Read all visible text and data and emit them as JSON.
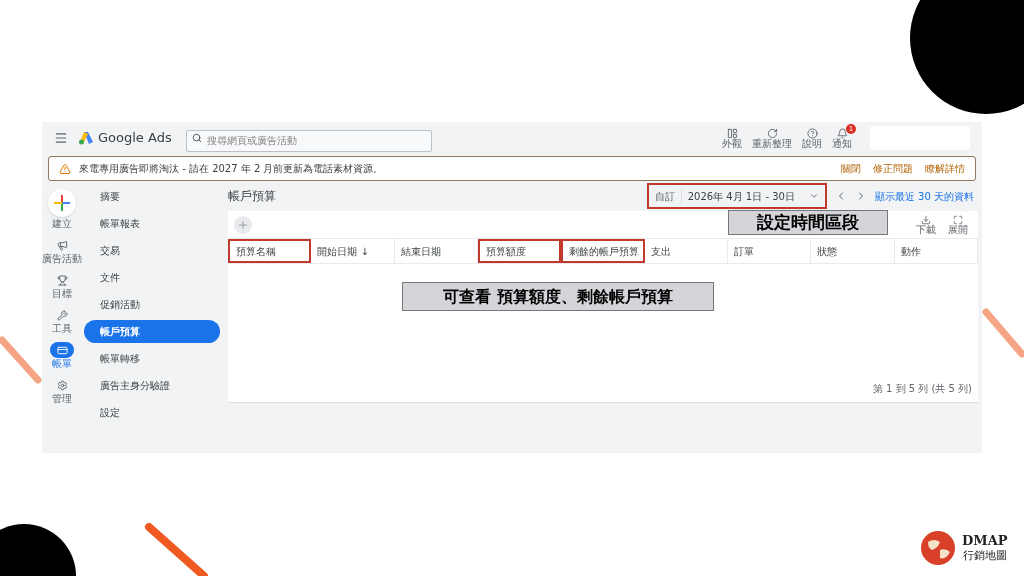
{
  "app": {
    "logo_text": "Google Ads",
    "search": {
      "placeholder": "搜尋網頁或廣告活動"
    },
    "top_actions": [
      {
        "kind": "appearance",
        "label": "外觀"
      },
      {
        "kind": "refresh",
        "label": "重新整理"
      },
      {
        "kind": "help",
        "label": "說明"
      },
      {
        "kind": "notifications",
        "label": "通知",
        "badge": "1"
      }
    ],
    "banner": {
      "message": "來電專用廣告即將淘汰 - 請在 2027 年 2 月前更新為電話素材資源。",
      "actions": [
        "關閉",
        "修正問題",
        "瞭解詳情"
      ]
    },
    "rail": [
      {
        "kind": "create",
        "label": "建立",
        "selected": false
      },
      {
        "kind": "campaigns",
        "label": "廣告活動",
        "selected": false
      },
      {
        "kind": "goals",
        "label": "目標",
        "selected": false
      },
      {
        "kind": "tools",
        "label": "工具",
        "selected": false
      },
      {
        "kind": "billing",
        "label": "帳單",
        "selected": true
      },
      {
        "kind": "admin",
        "label": "管理",
        "selected": false
      }
    ],
    "menu": [
      {
        "label": "摘要",
        "selected": false
      },
      {
        "label": "帳單報表",
        "selected": false
      },
      {
        "label": "交易",
        "selected": false
      },
      {
        "label": "文件",
        "selected": false
      },
      {
        "label": "促銷活動",
        "selected": false
      },
      {
        "label": "帳戶預算",
        "selected": true
      },
      {
        "label": "帳單轉移",
        "selected": false
      },
      {
        "label": "廣告主身分驗證",
        "selected": false
      },
      {
        "label": "設定",
        "selected": false
      }
    ],
    "page_title": "帳戶預算",
    "date_range": {
      "prefix": "自訂",
      "value": "2026年 4月 1日 - 30日",
      "highlighted": true
    },
    "recent_link": "顯示最近 30 天的資料",
    "table_tools": [
      {
        "kind": "download",
        "label": "下載"
      },
      {
        "kind": "expand",
        "label": "展開"
      }
    ],
    "table": {
      "columns": [
        {
          "label": "預算名稱",
          "highlighted": true
        },
        {
          "label": "開始日期 ↓",
          "highlighted": false
        },
        {
          "label": "結束日期",
          "highlighted": false
        },
        {
          "label": "預算額度",
          "highlighted": true
        },
        {
          "label": "剩餘的帳戶預算",
          "highlighted": true
        },
        {
          "label": "支出",
          "highlighted": false
        },
        {
          "label": "訂單",
          "highlighted": false
        },
        {
          "label": "狀態",
          "highlighted": false
        },
        {
          "label": "動作",
          "highlighted": false
        }
      ],
      "footer": "第 1 到 5 列 (共 5 列)"
    }
  },
  "annotations": {
    "date_note": "設定時間區段",
    "table_note": "可查看 預算額度、剩餘帳戶預算"
  },
  "brand": {
    "name": "DMAP",
    "tagline": "行銷地圖"
  }
}
